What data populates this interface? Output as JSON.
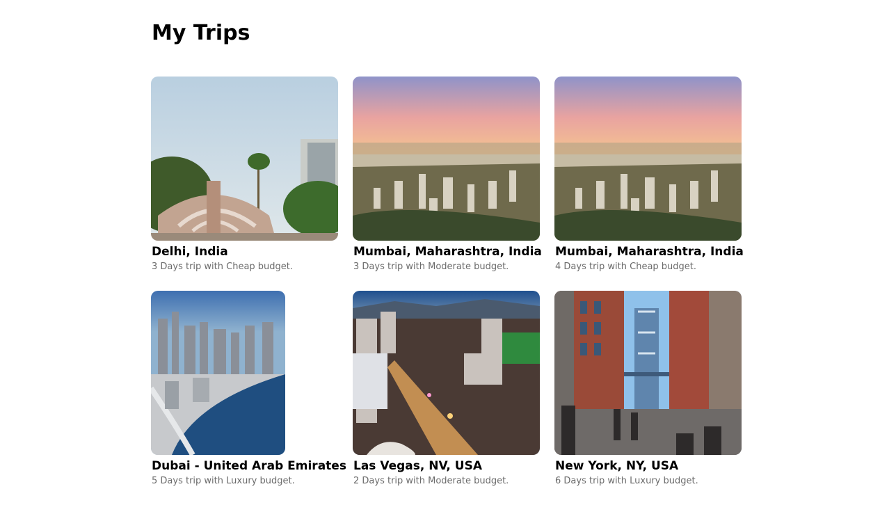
{
  "page": {
    "title": "My Trips"
  },
  "trips": [
    {
      "destination": "Delhi, India",
      "summary": "3 Days trip with Cheap budget."
    },
    {
      "destination": "Mumbai, Maharashtra, India",
      "summary": "3 Days trip with Moderate budget."
    },
    {
      "destination": "Mumbai, Maharashtra, India",
      "summary": "4 Days trip with Cheap budget."
    },
    {
      "destination": "Dubai - United Arab Emirates",
      "summary": "5 Days trip with Luxury budget."
    },
    {
      "destination": "Las Vegas, NV, USA",
      "summary": "2 Days trip with Moderate budget."
    },
    {
      "destination": "New York, NY, USA",
      "summary": "6 Days trip with Luxury budget."
    }
  ]
}
